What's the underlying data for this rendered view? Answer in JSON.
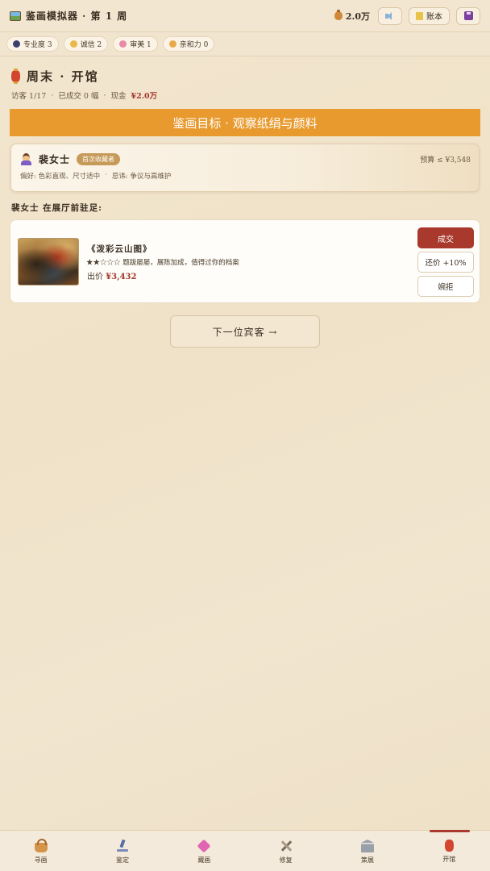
{
  "header": {
    "title": "鉴画模拟器 · 第 1 周",
    "money": "2.0万",
    "ledger_label": "账本",
    "icons": [
      "painting-logo-icon",
      "money-bag-icon",
      "sound-icon",
      "ledger-icon",
      "save-icon"
    ]
  },
  "stats": [
    {
      "label": "专业度 3",
      "color": "#3b3f6b"
    },
    {
      "label": "诚信 2",
      "color": "#e8b84a"
    },
    {
      "label": "审美 1",
      "color": "#e98aa6"
    },
    {
      "label": "亲和力 0",
      "color": "#e9a94a"
    }
  ],
  "scene": {
    "title": "周末 · 开馆",
    "visitors": "访客 1/17",
    "sold": "已成交 0 幅",
    "cash_label": "现金",
    "cash_value": "¥2.0万"
  },
  "banner": "鉴画目标 · 观察纸绢与颜料",
  "visitor": {
    "name": "裴女士",
    "badge": "首次收藏者",
    "budget": "预算 ≤ ¥3,548",
    "preference": "偏好: 色彩直观、尺寸适中",
    "avoid": "忌讳: 争议与高维护"
  },
  "prompt": "裴女士 在展厅前驻足:",
  "offer": {
    "title": "《泼彩云山图》",
    "desc": "★★☆☆☆ 题跋屡屡，展陈加成，值得过你的档案",
    "price_label": "出价",
    "price_value": "¥3,432",
    "deal_label": "成交",
    "counter_label": "还价 +10%",
    "reject_label": "婉拒"
  },
  "next_label": "下一位宾客 →",
  "nav": [
    {
      "label": "寻画",
      "icon": "basket-icon"
    },
    {
      "label": "鉴定",
      "icon": "microscope-icon"
    },
    {
      "label": "藏画",
      "icon": "gem-icon"
    },
    {
      "label": "修复",
      "icon": "tools-icon"
    },
    {
      "label": "策展",
      "icon": "museum-icon"
    },
    {
      "label": "开馆",
      "icon": "lantern-icon"
    }
  ],
  "colors": {
    "accent": "#e89a2e",
    "primary_button": "#a8392c",
    "price_red": "#a2372b",
    "background": "#f1e5cf"
  }
}
